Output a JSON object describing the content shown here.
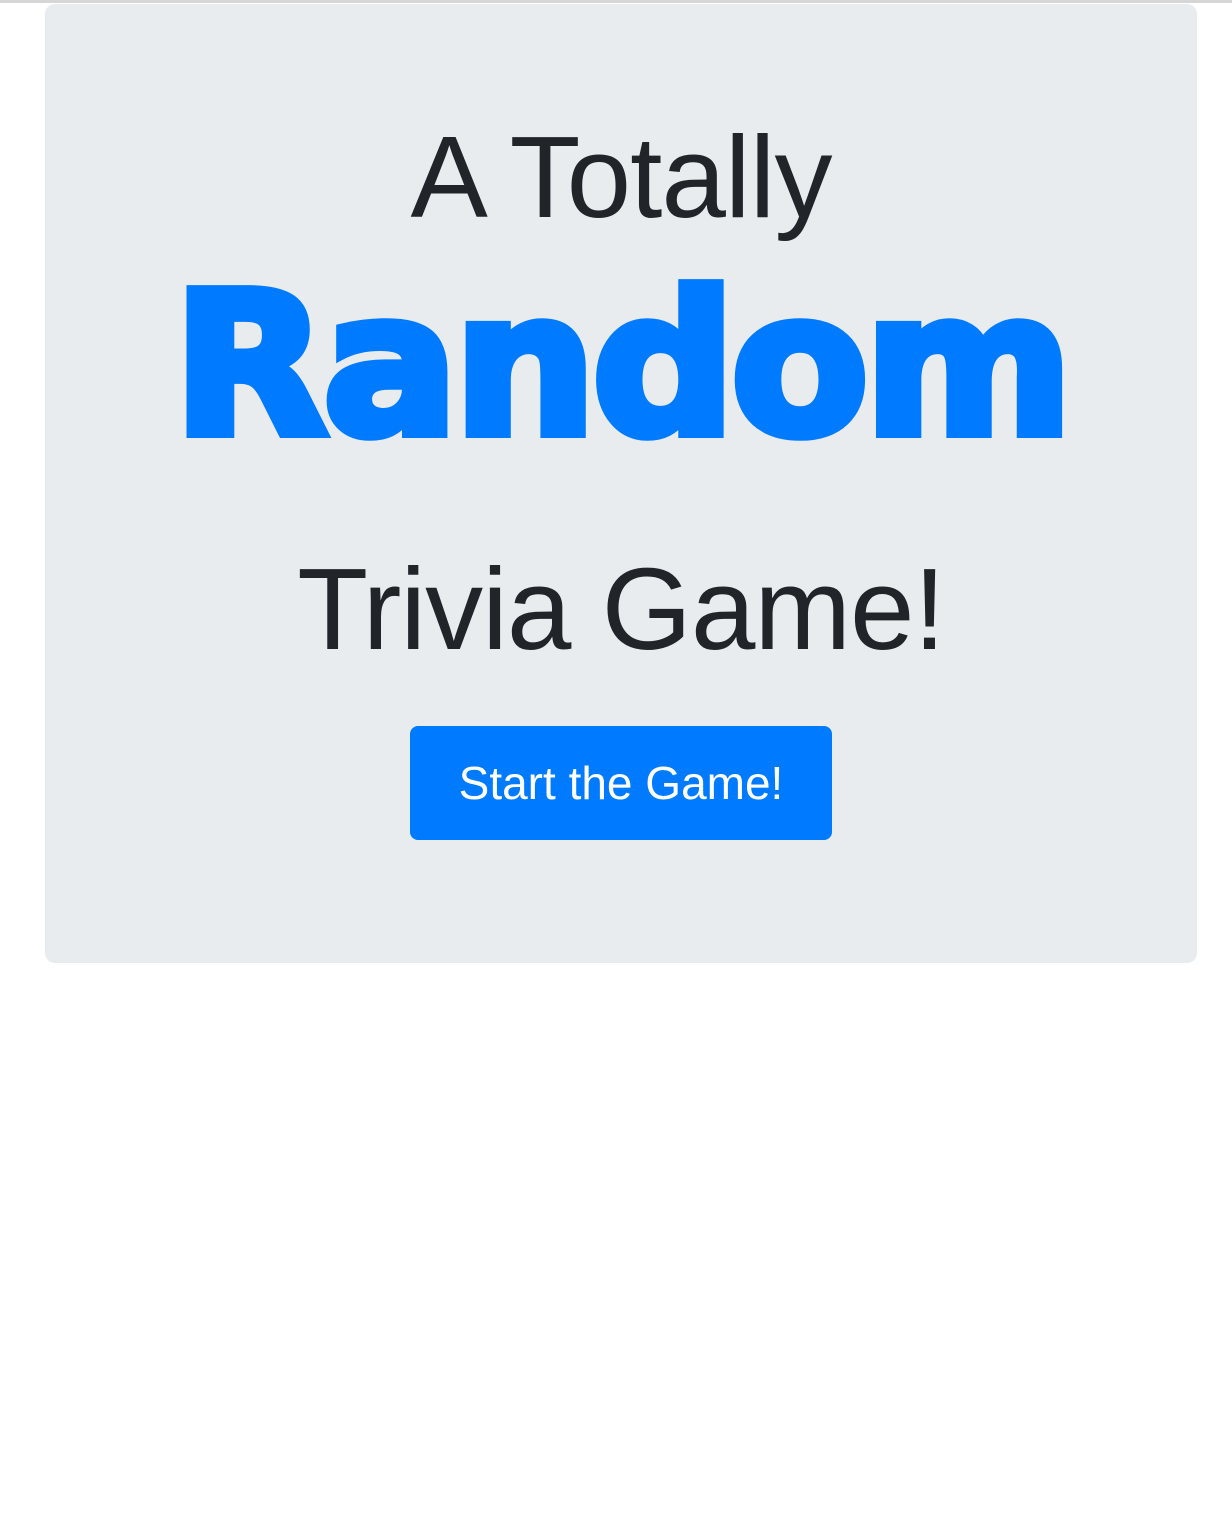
{
  "hero": {
    "line_top": "A Totally",
    "line_middle": "Random",
    "line_bottom": "Trivia Game!",
    "start_button_label": "Start the Game!"
  },
  "colors": {
    "accent": "#007bff",
    "panel": "#e9ecef",
    "text": "#212529"
  }
}
